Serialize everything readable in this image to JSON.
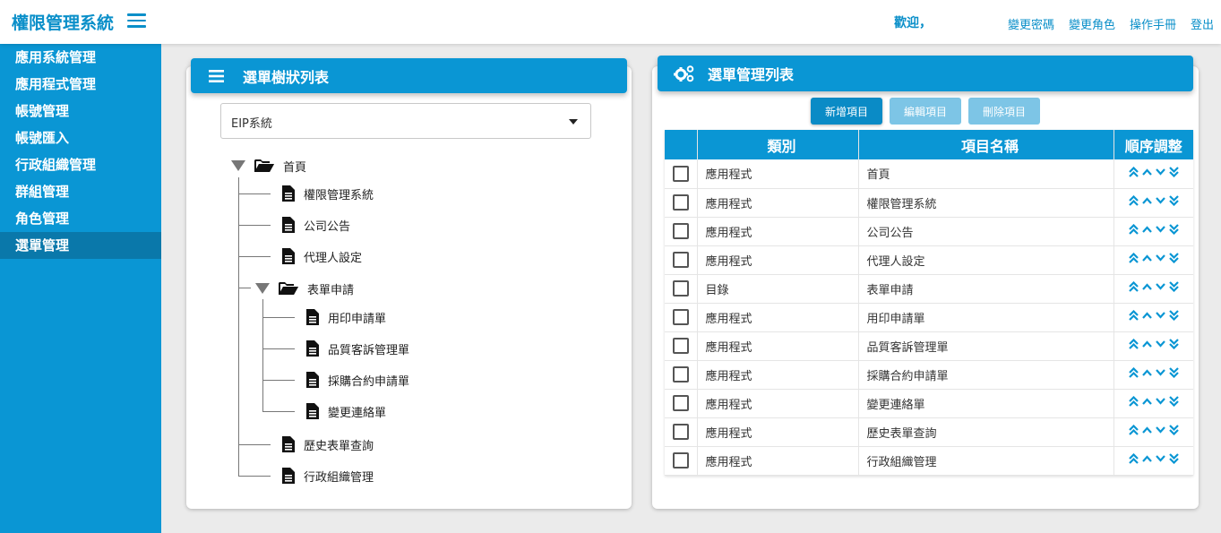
{
  "header": {
    "title": "權限管理系統",
    "welcome": "歡迎，",
    "links": [
      "變更密碼",
      "變更角色",
      "操作手冊",
      "登出"
    ]
  },
  "sidebar": {
    "items": [
      "應用系統管理",
      "應用程式管理",
      "帳號管理",
      "帳號匯入",
      "行政組織管理",
      "群組管理",
      "角色管理",
      "選單管理"
    ],
    "active": "選單管理"
  },
  "left_panel": {
    "title": "選單樹狀列表",
    "select_value": "EIP系統",
    "tree": {
      "root": "首頁",
      "root_children": [
        "權限管理系統",
        "公司公告",
        "代理人設定"
      ],
      "folder": "表單申請",
      "folder_children": [
        "用印申請單",
        "品質客訴管理單",
        "採購合約申請單",
        "變更連絡單"
      ],
      "after_folder": [
        "歷史表單查詢",
        "行政組織管理"
      ]
    }
  },
  "right_panel": {
    "title": "選單管理列表",
    "buttons": {
      "add": "新增項目",
      "edit": "編輯項目",
      "delete": "刪除項目"
    },
    "columns": [
      "類別",
      "項目名稱",
      "順序調整"
    ],
    "rows": [
      {
        "type": "應用程式",
        "name": "首頁"
      },
      {
        "type": "應用程式",
        "name": "權限管理系統"
      },
      {
        "type": "應用程式",
        "name": "公司公告"
      },
      {
        "type": "應用程式",
        "name": "代理人設定"
      },
      {
        "type": "目錄",
        "name": "表單申請"
      },
      {
        "type": "應用程式",
        "name": "用印申請單"
      },
      {
        "type": "應用程式",
        "name": "品質客訴管理單"
      },
      {
        "type": "應用程式",
        "name": "採購合約申請單"
      },
      {
        "type": "應用程式",
        "name": "變更連絡單"
      },
      {
        "type": "應用程式",
        "name": "歷史表單查詢"
      },
      {
        "type": "應用程式",
        "name": "行政組織管理"
      }
    ]
  },
  "colors": {
    "primary": "#0a96d4",
    "active_nav": "#0a78aa",
    "button_disabled": "#7dc5e6"
  },
  "icons": [
    "menu-icon",
    "cogs-icon",
    "folder-open-icon",
    "file-icon",
    "double-chevron-up-icon",
    "chevron-up-icon",
    "chevron-down-icon",
    "double-chevron-down-icon"
  ]
}
